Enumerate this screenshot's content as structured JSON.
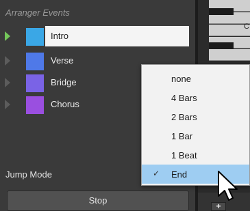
{
  "panel": {
    "title": "Arranger Events",
    "events": [
      {
        "label": "Intro",
        "color": "#3aa7e6",
        "active": true
      },
      {
        "label": "Verse",
        "color": "#4f79e8",
        "active": false
      },
      {
        "label": "Bridge",
        "color": "#7a63e6",
        "active": false
      },
      {
        "label": "Chorus",
        "color": "#9a4fe0",
        "active": false
      }
    ],
    "jump_mode_label": "Jump Mode",
    "stop_label": "Stop"
  },
  "keys": {
    "c_label": "C",
    "add_label": "+"
  },
  "menu": {
    "items": [
      "none",
      "4 Bars",
      "2 Bars",
      "1 Bar",
      "1 Beat",
      "End"
    ],
    "selected": "End",
    "check_glyph": "✓"
  },
  "colors": {
    "menu_selected": "#9ecdf2",
    "active_triangle": "#74c65a"
  }
}
